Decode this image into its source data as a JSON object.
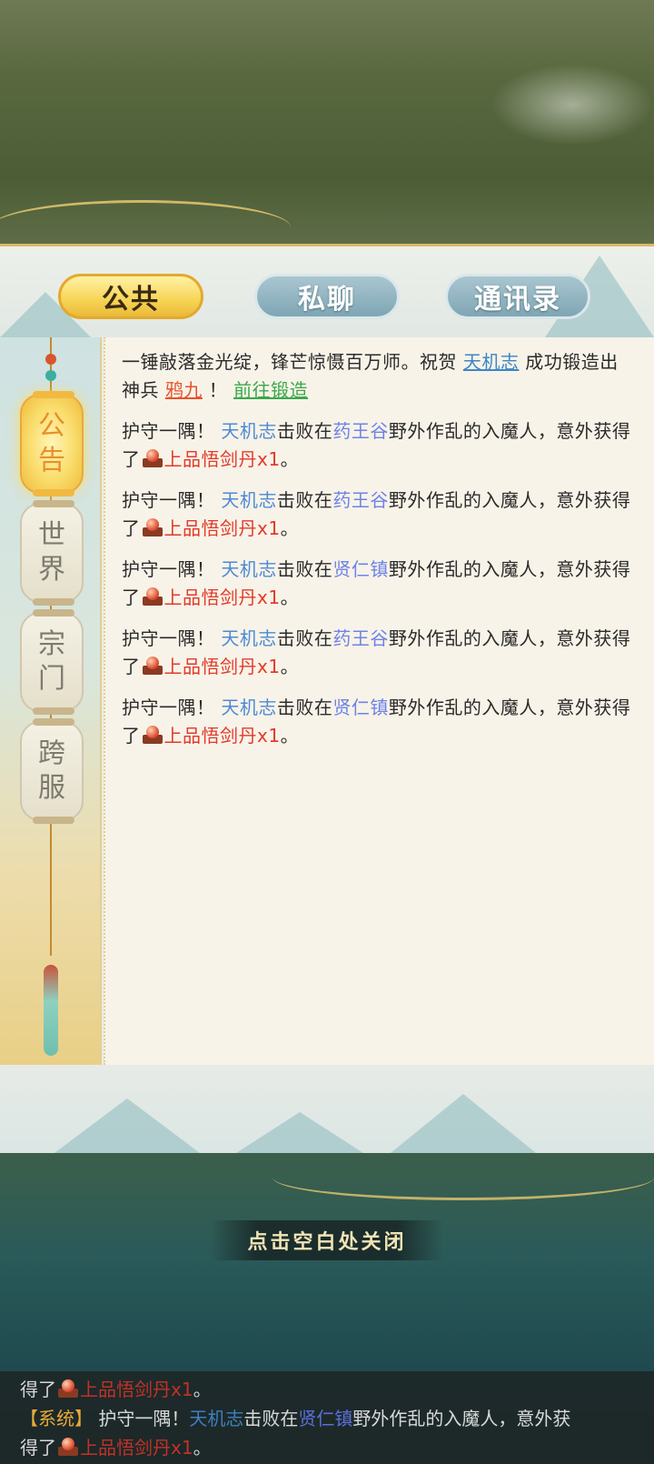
{
  "tabs": {
    "public": "公共",
    "private": "私聊",
    "contacts": "通讯录"
  },
  "sidebar": {
    "items": [
      {
        "chars": [
          "公",
          "告"
        ],
        "active": true
      },
      {
        "chars": [
          "世",
          "界"
        ],
        "active": false
      },
      {
        "chars": [
          "宗",
          "门"
        ],
        "active": false
      },
      {
        "chars": [
          "跨",
          "服"
        ],
        "active": false
      }
    ]
  },
  "messages": {
    "forge": {
      "text_1": "一锤敲落金光绽，锋芒惊慑百万师。祝贺 ",
      "player": "天机志",
      "text_2": " 成功锻造出神兵 ",
      "weapon": "鸦九",
      "text_3": " ！  ",
      "action": "前往锻造"
    },
    "kills": [
      {
        "prefix": "护守一隅！ ",
        "player": "天机志",
        "mid": "击败在",
        "place": "药王谷",
        "suffix": "野外作乱的入魔人，意外获得了",
        "item": "上品悟剑丹x1",
        "end": "。"
      },
      {
        "prefix": "护守一隅！ ",
        "player": "天机志",
        "mid": "击败在",
        "place": "药王谷",
        "suffix": "野外作乱的入魔人，意外获得了",
        "item": "上品悟剑丹x1",
        "end": "。"
      },
      {
        "prefix": "护守一隅！ ",
        "player": "天机志",
        "mid": "击败在",
        "place": "贤仁镇",
        "suffix": "野外作乱的入魔人，意外获得了",
        "item": "上品悟剑丹x1",
        "end": "。"
      },
      {
        "prefix": "护守一隅！ ",
        "player": "天机志",
        "mid": "击败在",
        "place": "药王谷",
        "suffix": "野外作乱的入魔人，意外获得了",
        "item": "上品悟剑丹x1",
        "end": "。"
      },
      {
        "prefix": "护守一隅！ ",
        "player": "天机志",
        "mid": "击败在",
        "place": "贤仁镇",
        "suffix": "野外作乱的入魔人，意外获得了",
        "item": "上品悟剑丹x1",
        "end": "。"
      }
    ]
  },
  "close_hint": "点击空白处关闭",
  "chat_strip": {
    "line1_prefix": "得了",
    "line1_item": "上品悟剑丹x1",
    "line1_end": "。",
    "line2_tag": "【系统】",
    "line2_text": " 护守一隅！",
    "line2_player": "天机志",
    "line2_mid": "击败在",
    "line2_place": "贤仁镇",
    "line2_suffix": "野外作乱的入魔人，意外获",
    "line3_prefix": "得了",
    "line3_item": "上品悟剑丹x1",
    "line3_end": "。"
  },
  "colors": {
    "player": "#4d8ad6",
    "place": "#6d83e8",
    "item": "#e23a2a",
    "weapon": "#e6522c",
    "action": "#3aa84a"
  }
}
